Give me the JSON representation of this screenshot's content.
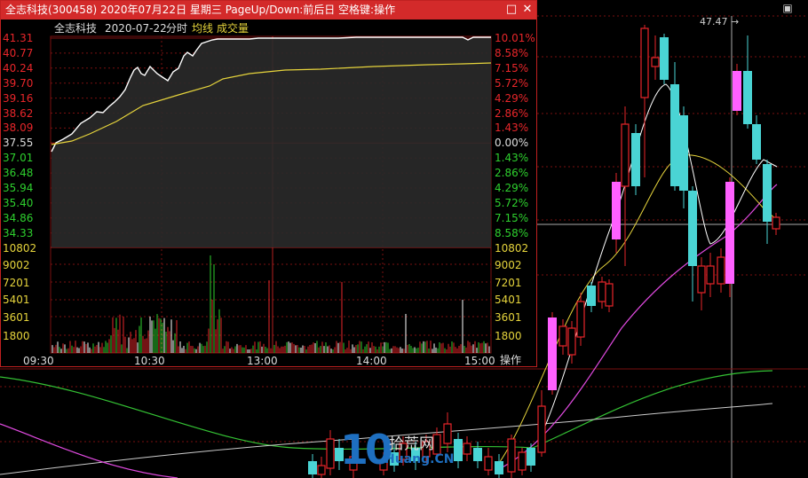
{
  "popup": {
    "title": "全志科技(300458)  2020年07月22日  星期三  PageUp/Down:前后日  空格键:操作",
    "minimize_label": "□",
    "close_label": "✕",
    "stock_name": "全志科技",
    "date": "2020-07-22",
    "mode": "分时",
    "avg_label": "均线",
    "vol_label": "成交量",
    "price_labels_left": [
      "41.31",
      "40.77",
      "40.24",
      "39.70",
      "39.16",
      "38.62",
      "38.09",
      "37.55",
      "37.01",
      "36.48",
      "35.94",
      "35.40",
      "34.86",
      "34.33"
    ],
    "pct_labels_right": [
      "10.01%",
      "8.58%",
      "7.15%",
      "5.72%",
      "4.29%",
      "2.86%",
      "1.43%",
      "0.00%",
      "1.43%",
      "2.86%",
      "4.29%",
      "5.72%",
      "7.15%",
      "8.58%"
    ],
    "vol_labels_left": [
      "10802",
      "9002",
      "7201",
      "5401",
      "3601",
      "1800"
    ],
    "vol_labels_right": [
      "10802",
      "9002",
      "7201",
      "5401",
      "3601",
      "1800"
    ],
    "time_labels": [
      "09:30",
      "10:30",
      "13:00",
      "14:00",
      "15:00"
    ],
    "action_label": "操作"
  },
  "main_chart": {
    "peak_label": "47.47",
    "corner_icon": "square-icon"
  },
  "watermark": {
    "logo_number": "10",
    "cn_text": "拾荒网",
    "en_text": "Huang.CN"
  },
  "colors": {
    "title_bg": "#d32a2a",
    "up": "#e8262a",
    "down": "#4ad4d4",
    "limit": "#ff60ff",
    "avg": "#e6d43c",
    "price_line": "#ffffff",
    "grid": "#7a1010"
  }
}
